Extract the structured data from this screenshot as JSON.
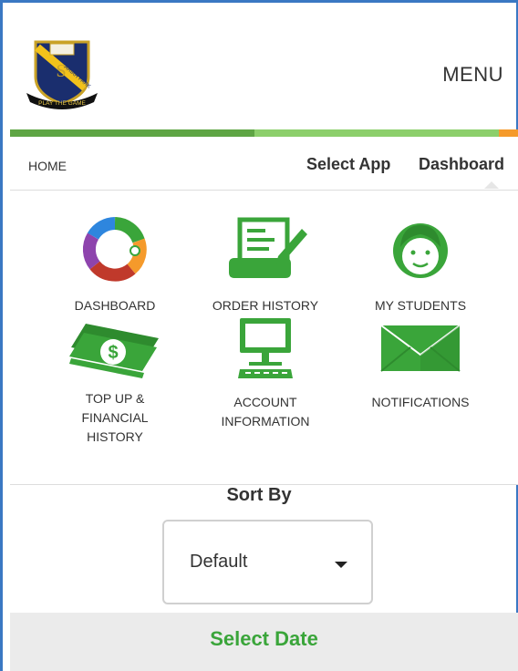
{
  "header": {
    "logo": {
      "school_name": "ARIAH PARK",
      "motto": "PLAY THE GAME"
    },
    "menu_label": "MENU"
  },
  "progress": {
    "colors": [
      "#5ea544",
      "#8ccf6b",
      "#f59a2b"
    ]
  },
  "breadcrumb": {
    "home": "HOME",
    "select_app": "Select App",
    "dashboard": "Dashboard"
  },
  "apps": [
    {
      "label": "DASHBOARD",
      "icon": "donut-chart-icon"
    },
    {
      "label": "ORDER HISTORY",
      "icon": "receipt-pen-icon"
    },
    {
      "label": "MY STUDENTS",
      "icon": "student-face-icon"
    },
    {
      "label": "TOP UP & FINANCIAL HISTORY",
      "icon": "money-icon"
    },
    {
      "label": "ACCOUNT INFORMATION",
      "icon": "computer-icon"
    },
    {
      "label": "NOTIFICATIONS",
      "icon": "envelope-icon"
    }
  ],
  "sort": {
    "title": "Sort By",
    "selected": "Default"
  },
  "date": {
    "label": "Select Date"
  },
  "colors": {
    "accent_green": "#3aa53a",
    "frame_blue": "#3a78c3"
  }
}
